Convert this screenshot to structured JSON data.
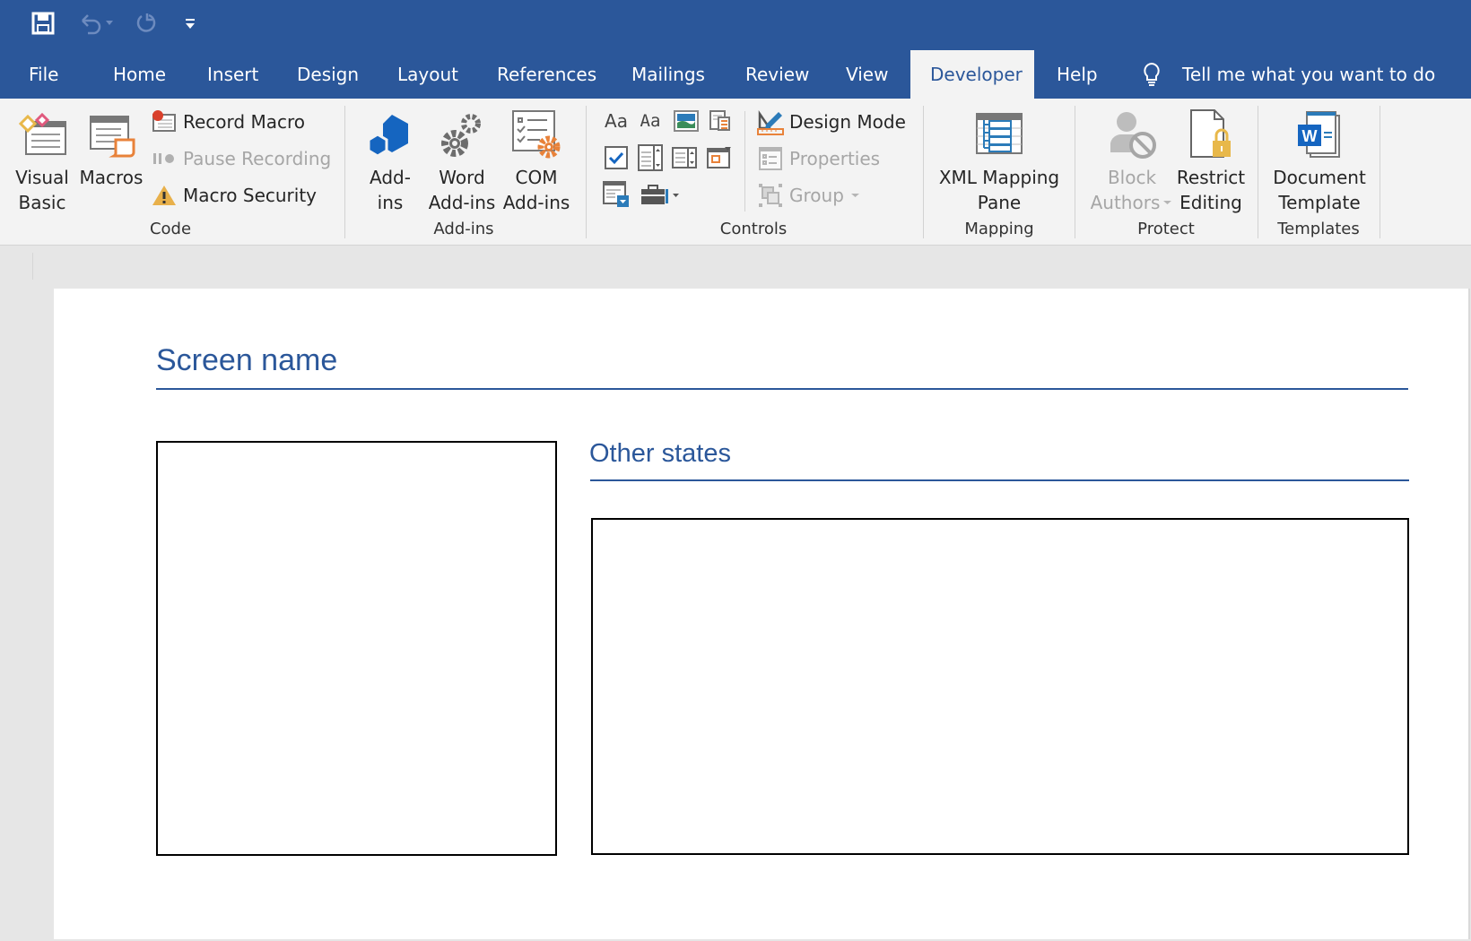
{
  "qat": {
    "save": "save-icon",
    "undo": "undo-icon",
    "redo": "redo-icon",
    "customize": "customize-qat-icon"
  },
  "tabs": [
    {
      "label": "File",
      "active": false
    },
    {
      "label": "Home",
      "active": false
    },
    {
      "label": "Insert",
      "active": false
    },
    {
      "label": "Design",
      "active": false
    },
    {
      "label": "Layout",
      "active": false
    },
    {
      "label": "References",
      "active": false
    },
    {
      "label": "Mailings",
      "active": false
    },
    {
      "label": "Review",
      "active": false
    },
    {
      "label": "View",
      "active": false
    },
    {
      "label": "Developer",
      "active": true
    },
    {
      "label": "Help",
      "active": false
    }
  ],
  "tell_me": {
    "label": "Tell me what you want to do",
    "icon": "lightbulb-icon"
  },
  "ribbon": {
    "code": {
      "label": "Code",
      "visual_basic": [
        "Visual",
        "Basic"
      ],
      "macros": "Macros",
      "record_macro": "Record Macro",
      "pause_recording": "Pause Recording",
      "macro_security": "Macro Security"
    },
    "addins": {
      "label": "Add-ins",
      "addins": [
        "Add-",
        "ins"
      ],
      "word_addins": [
        "Word",
        "Add-ins"
      ],
      "com_addins": [
        "COM",
        "Add-ins"
      ]
    },
    "controls": {
      "label": "Controls",
      "rich_text": "Aa",
      "plain_text": "Aa",
      "design_mode": "Design Mode",
      "properties": "Properties",
      "group": "Group"
    },
    "mapping": {
      "label": "Mapping",
      "xml_mapping": [
        "XML Mapping",
        "Pane"
      ]
    },
    "protect": {
      "label": "Protect",
      "block_authors": [
        "Block",
        "Authors"
      ],
      "restrict_editing": [
        "Restrict",
        "Editing"
      ]
    },
    "templates": {
      "label": "Templates",
      "document_template": [
        "Document",
        "Template"
      ]
    }
  },
  "document": {
    "heading": "Screen name",
    "subheading": "Other states"
  },
  "colors": {
    "brand": "#2b579a",
    "ribbon_bg": "#f3f3f3",
    "heading": "#2b579a"
  }
}
